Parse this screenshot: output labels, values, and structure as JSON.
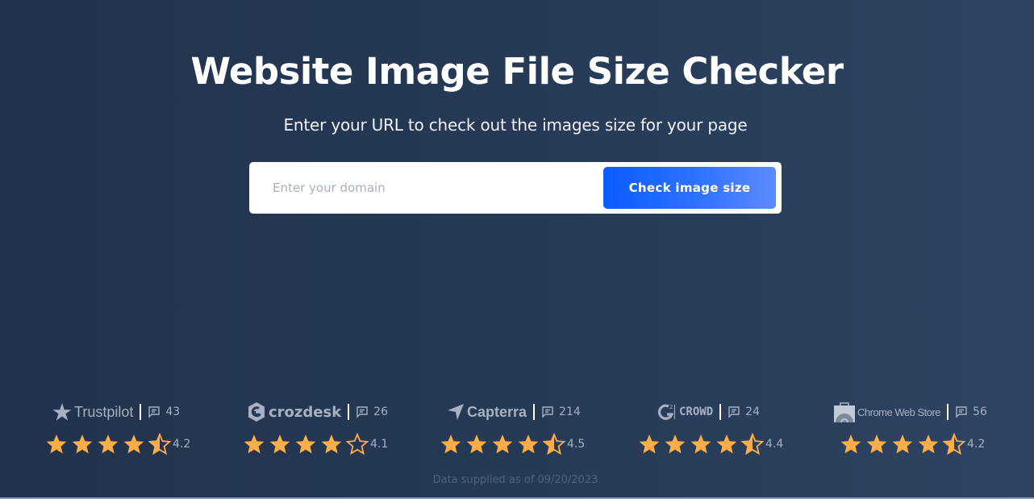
{
  "header": {
    "title": "Website Image File Size Checker",
    "subtitle": "Enter your URL to check out the images size for your page"
  },
  "search": {
    "placeholder": "Enter your domain",
    "value": "",
    "button_label": "Check image size"
  },
  "colors": {
    "accent": "#0a5cff",
    "star": "#ffad47",
    "muted_text": "#a7b1c2"
  },
  "reviews": [
    {
      "brand": "Trustpilot",
      "icon": "trustpilot-star-icon",
      "count": "43",
      "rating": "4.2",
      "rating_value": 4.2
    },
    {
      "brand": "crozdesk",
      "icon": "crozdesk-logo-icon",
      "count": "26",
      "rating": "4.1",
      "rating_value": 4.1
    },
    {
      "brand": "Capterra",
      "icon": "capterra-arrow-icon",
      "count": "214",
      "rating": "4.5",
      "rating_value": 4.5
    },
    {
      "brand": "CROWD",
      "icon": "g2-logo-icon",
      "count": "24",
      "rating": "4.4",
      "rating_value": 4.4
    },
    {
      "brand": "Chrome Web Store",
      "icon": "chrome-web-store-icon",
      "count": "56",
      "rating": "4.2",
      "rating_value": 4.2
    }
  ],
  "footnote": "Data supplied as of 09/20/2023"
}
